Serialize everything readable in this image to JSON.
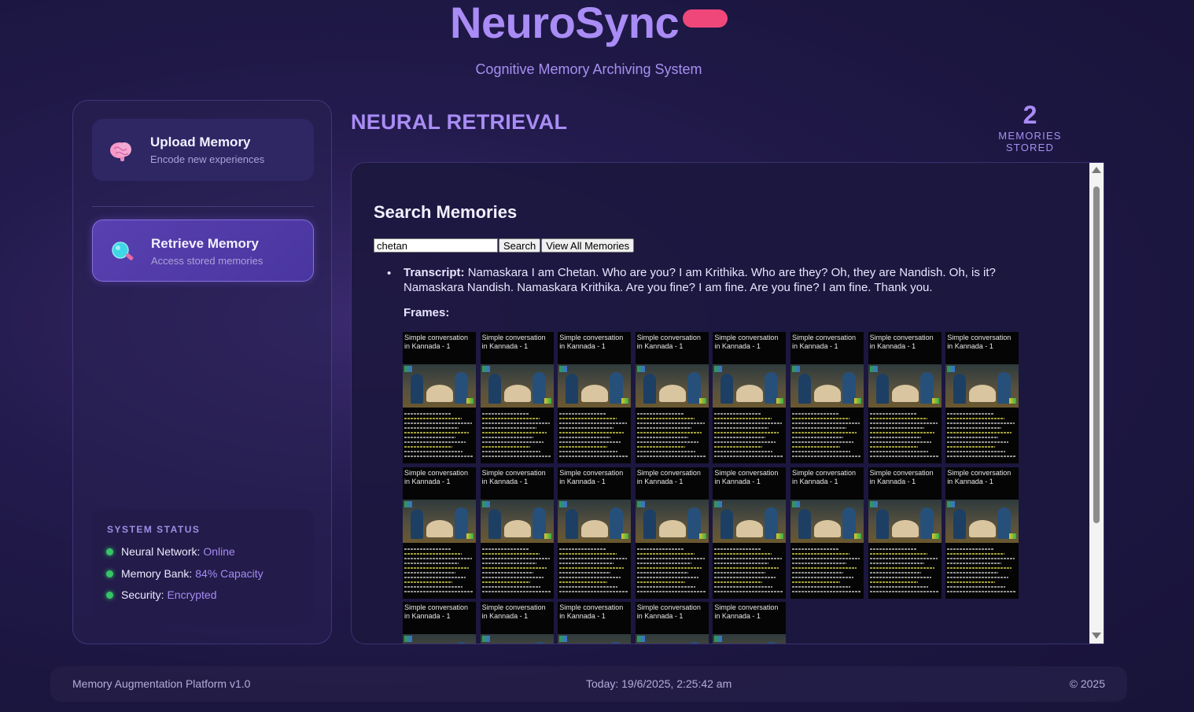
{
  "app": {
    "title": "NeuroSync",
    "subtitle": "Cognitive Memory Archiving System",
    "accent_color": "#a98cf5",
    "pill_color": "#f0477a"
  },
  "sidebar": {
    "items": [
      {
        "title": "Upload Memory",
        "subtitle": "Encode new experiences",
        "icon": "brain-icon",
        "active": false
      },
      {
        "title": "Retrieve Memory",
        "subtitle": "Access stored memories",
        "icon": "magnifier-icon",
        "active": true
      }
    ],
    "status": {
      "heading": "SYSTEM STATUS",
      "rows": [
        {
          "label": "Neural Network:",
          "value": "Online"
        },
        {
          "label": "Memory Bank:",
          "value": "84% Capacity"
        },
        {
          "label": "Security:",
          "value": "Encrypted"
        }
      ],
      "dot_color": "#35c567"
    }
  },
  "main": {
    "section_title": "NEURAL RETRIEVAL",
    "memory_count": "2",
    "memory_count_label": "MEMORIES STORED",
    "search": {
      "heading": "Search Memories",
      "query": "chetan",
      "search_button": "Search",
      "view_all_button": "View All Memories"
    },
    "result": {
      "transcript_label": "Transcript:",
      "transcript_text": "Namaskara I am Chetan. Who are you? I am Krithika. Who are they? Oh, they are Nandish. Oh, is it? Namaskara Nandish. Namaskara Krithika. Are you fine? I am fine. Are you fine? I am fine. Thank you.",
      "frames_label": "Frames:",
      "frame_title": "Simple conversation in Kannada - 1",
      "frame_count": 21
    }
  },
  "footer": {
    "left": "Memory Augmentation Platform v1.0",
    "center": "Today: 19/6/2025, 2:25:42 am",
    "right": "© 2025"
  }
}
